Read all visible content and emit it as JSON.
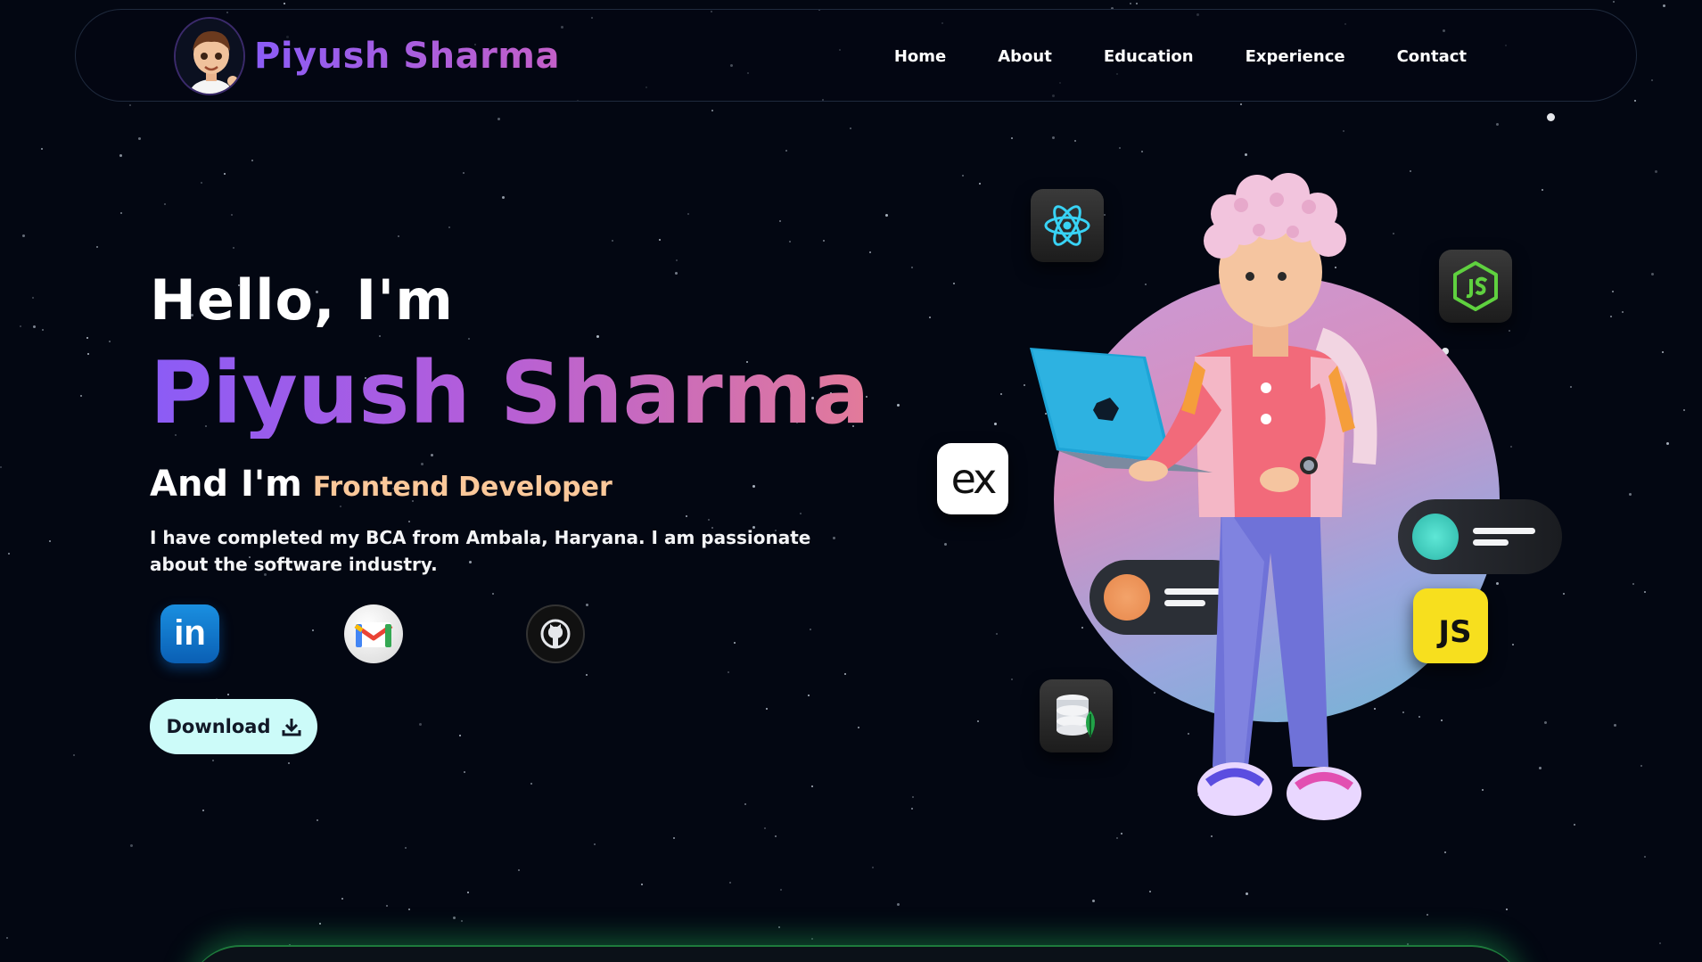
{
  "brand": {
    "name": "Piyush Sharma",
    "avatar_icon": "cartoon-avatar-icon"
  },
  "nav": {
    "items": [
      {
        "label": "Home"
      },
      {
        "label": "About"
      },
      {
        "label": "Education"
      },
      {
        "label": "Experience"
      },
      {
        "label": "Contact"
      }
    ]
  },
  "hero": {
    "greeting": "Hello, I'm",
    "name": "Piyush Sharma",
    "role_prefix": "And I'm",
    "role": "Frontend Developer",
    "bio": "I have completed my BCA from Ambala, Haryana. I am passionate about the software industry.",
    "download_label": "Download"
  },
  "socials": [
    {
      "name": "LinkedIn",
      "icon": "linkedin-icon",
      "glyph": "in"
    },
    {
      "name": "Gmail",
      "icon": "gmail-icon"
    },
    {
      "name": "GitHub",
      "icon": "github-icon"
    }
  ],
  "tech_icons": {
    "express_glyph": "ex",
    "js_glyph": "JS"
  },
  "colors": {
    "background": "#030712",
    "brand_gradient_start": "#8b5cf6",
    "brand_gradient_end": "#c45fc8",
    "role_color": "#fbc89a",
    "download_bg": "#ccfbf9"
  }
}
